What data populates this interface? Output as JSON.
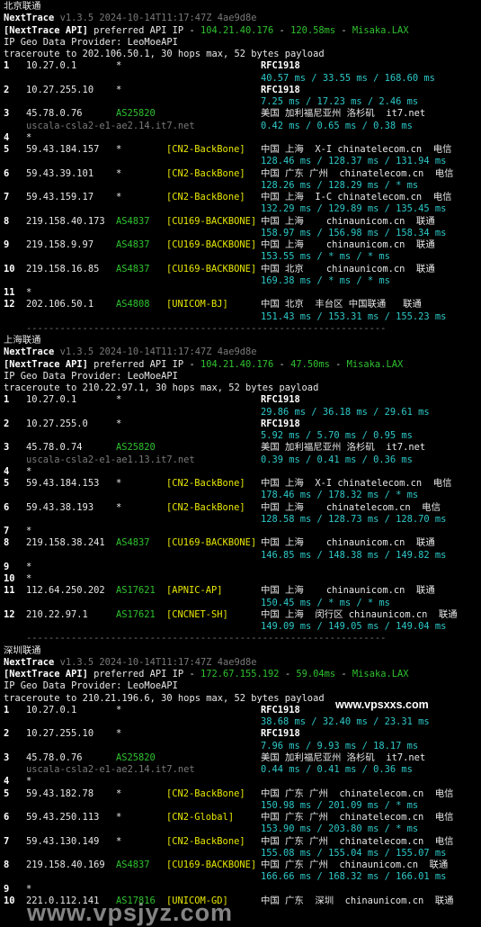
{
  "blocks": [
    {
      "header": "北京联通",
      "version": "v1.3.5 2024-10-14T11:17:47Z 4ae9d8e",
      "api_ip": "104.21.40.176",
      "api_latency": "120.58ms",
      "api_node": "Misaka.LAX",
      "traceroute": "traceroute to 202.106.50.1, 30 hops max, 52 bytes payload",
      "hops": [
        {
          "n": "1",
          "ip": "10.27.0.1",
          "asn": "*",
          "tag": "",
          "geo": "RFC1918",
          "rtt": "40.57 ms / 33.55 ms / 168.60 ms",
          "sub": ""
        },
        {
          "n": "2",
          "ip": "10.27.255.10",
          "asn": "*",
          "tag": "",
          "geo": "RFC1918",
          "rtt": "7.25 ms / 17.23 ms / 2.46 ms",
          "sub": ""
        },
        {
          "n": "3",
          "ip": "45.78.0.76",
          "asn": "AS25820",
          "tag": "",
          "geo": "美国 加利福尼亚州 洛杉矶  it7.net",
          "rtt": "0.42 ms / 0.65 ms / 0.38 ms",
          "sub": "uscala-csla2-e1-ae2.14.it7.net"
        },
        {
          "n": "4",
          "ip": "*",
          "asn": "",
          "tag": "",
          "geo": "",
          "rtt": "",
          "sub": ""
        },
        {
          "n": "5",
          "ip": "59.43.184.157",
          "asn": "*",
          "tag": "[CN2-BackBone]",
          "geo": "中国 上海  X-I chinatelecom.cn  电信",
          "rtt": "128.46 ms / 128.37 ms / 131.94 ms",
          "sub": ""
        },
        {
          "n": "6",
          "ip": "59.43.39.101",
          "asn": "*",
          "tag": "[CN2-BackBone]",
          "geo": "中国 广东 广州  chinatelecom.cn  电信",
          "rtt": "128.26 ms / 128.29 ms / * ms",
          "sub": ""
        },
        {
          "n": "7",
          "ip": "59.43.159.17",
          "asn": "*",
          "tag": "[CN2-BackBone]",
          "geo": "中国 上海  I-C chinatelecom.cn  电信",
          "rtt": "132.29 ms / 129.89 ms / 135.45 ms",
          "sub": ""
        },
        {
          "n": "8",
          "ip": "219.158.40.173",
          "asn": "AS4837",
          "tag": "[CU169-BACKBONE]",
          "geo": "中国 上海    chinaunicom.cn  联通",
          "rtt": "158.97 ms / 156.98 ms / 158.34 ms",
          "sub": ""
        },
        {
          "n": "9",
          "ip": "219.158.9.97",
          "asn": "AS4837",
          "tag": "[CU169-BACKBONE]",
          "geo": "中国 上海    chinaunicom.cn  联通",
          "rtt": "153.55 ms / * ms / * ms",
          "sub": ""
        },
        {
          "n": "10",
          "ip": "219.158.16.85",
          "asn": "AS4837",
          "tag": "[CU169-BACKBONE]",
          "geo": "中国 北京    chinaunicom.cn  联通",
          "rtt": "169.38 ms / * ms / * ms",
          "sub": ""
        },
        {
          "n": "11",
          "ip": "*",
          "asn": "",
          "tag": "",
          "geo": "",
          "rtt": "",
          "sub": ""
        },
        {
          "n": "12",
          "ip": "202.106.50.1",
          "asn": "AS4808",
          "tag": "[UNICOM-BJ]",
          "geo": "中国 北京  丰台区 中国联通   联通",
          "rtt": "151.43 ms / 153.31 ms / 155.23 ms",
          "sub": ""
        }
      ]
    },
    {
      "header": "上海联通",
      "version": "v1.3.5 2024-10-14T11:17:47Z 4ae9d8e",
      "api_ip": "104.21.40.176",
      "api_latency": "47.50ms",
      "api_node": "Misaka.LAX",
      "traceroute": "traceroute to 210.22.97.1, 30 hops max, 52 bytes payload",
      "hops": [
        {
          "n": "1",
          "ip": "10.27.0.1",
          "asn": "*",
          "tag": "",
          "geo": "RFC1918",
          "rtt": "29.86 ms / 36.18 ms / 29.61 ms",
          "sub": ""
        },
        {
          "n": "2",
          "ip": "10.27.255.0",
          "asn": "*",
          "tag": "",
          "geo": "RFC1918",
          "rtt": "5.92 ms / 5.70 ms / 0.95 ms",
          "sub": ""
        },
        {
          "n": "3",
          "ip": "45.78.0.74",
          "asn": "AS25820",
          "tag": "",
          "geo": "美国 加利福尼亚州 洛杉矶  it7.net",
          "rtt": "0.39 ms / 0.41 ms / 0.36 ms",
          "sub": "uscala-csla2-e1-ae1.13.it7.net"
        },
        {
          "n": "4",
          "ip": "*",
          "asn": "",
          "tag": "",
          "geo": "",
          "rtt": "",
          "sub": ""
        },
        {
          "n": "5",
          "ip": "59.43.184.153",
          "asn": "*",
          "tag": "[CN2-BackBone]",
          "geo": "中国 上海  X-I chinatelecom.cn  电信",
          "rtt": "178.46 ms / 178.32 ms / * ms",
          "sub": ""
        },
        {
          "n": "6",
          "ip": "59.43.38.193",
          "asn": "*",
          "tag": "[CN2-BackBone]",
          "geo": "中国 上海    chinatelecom.cn  电信",
          "rtt": "128.58 ms / 128.73 ms / 128.70 ms",
          "sub": ""
        },
        {
          "n": "7",
          "ip": "*",
          "asn": "",
          "tag": "",
          "geo": "",
          "rtt": "",
          "sub": ""
        },
        {
          "n": "8",
          "ip": "219.158.38.241",
          "asn": "AS4837",
          "tag": "[CU169-BACKBONE]",
          "geo": "中国 上海    chinaunicom.cn  联通",
          "rtt": "146.85 ms / 148.38 ms / 149.82 ms",
          "sub": ""
        },
        {
          "n": "9",
          "ip": "*",
          "asn": "",
          "tag": "",
          "geo": "",
          "rtt": "",
          "sub": ""
        },
        {
          "n": "10",
          "ip": "*",
          "asn": "",
          "tag": "",
          "geo": "",
          "rtt": "",
          "sub": ""
        },
        {
          "n": "11",
          "ip": "112.64.250.202",
          "asn": "AS17621",
          "tag": "[APNIC-AP]",
          "geo": "中国 上海    chinaunicom.cn  联通",
          "rtt": "150.45 ms / * ms / * ms",
          "sub": ""
        },
        {
          "n": "12",
          "ip": "210.22.97.1",
          "asn": "AS17621",
          "tag": "[CNCNET-SH]",
          "geo": "中国 上海  闵行区 chinaunicom.cn  联通",
          "rtt": "149.09 ms / 149.05 ms / 149.04 ms",
          "sub": ""
        }
      ]
    },
    {
      "header": "深圳联通",
      "version": "v1.3.5 2024-10-14T11:17:47Z 4ae9d8e",
      "api_ip": "172.67.155.192",
      "api_latency": "59.04ms",
      "api_node": "Misaka.LAX",
      "traceroute": "traceroute to 210.21.196.6, 30 hops max, 52 bytes payload",
      "hops": [
        {
          "n": "1",
          "ip": "10.27.0.1",
          "asn": "*",
          "tag": "",
          "geo": "RFC1918",
          "rtt": "38.68 ms / 32.40 ms / 23.31 ms",
          "sub": ""
        },
        {
          "n": "2",
          "ip": "10.27.255.10",
          "asn": "*",
          "tag": "",
          "geo": "RFC1918",
          "rtt": "7.96 ms / 9.93 ms / 18.17 ms",
          "sub": ""
        },
        {
          "n": "3",
          "ip": "45.78.0.76",
          "asn": "AS25820",
          "tag": "",
          "geo": "美国 加利福尼亚州 洛杉矶  it7.net",
          "rtt": "0.44 ms / 0.41 ms / 0.36 ms",
          "sub": "uscala-csla2-e1-ae2.14.it7.net"
        },
        {
          "n": "4",
          "ip": "*",
          "asn": "",
          "tag": "",
          "geo": "",
          "rtt": "",
          "sub": ""
        },
        {
          "n": "5",
          "ip": "59.43.182.78",
          "asn": "*",
          "tag": "[CN2-BackBone]",
          "geo": "中国 广东 广州  chinatelecom.cn  电信",
          "rtt": "150.98 ms / 201.09 ms / * ms",
          "sub": ""
        },
        {
          "n": "6",
          "ip": "59.43.250.113",
          "asn": "*",
          "tag": "[CN2-Global]",
          "geo": "中国 广东 广州  chinatelecom.cn  电信",
          "rtt": "153.90 ms / 203.80 ms / * ms",
          "sub": ""
        },
        {
          "n": "7",
          "ip": "59.43.130.149",
          "asn": "*",
          "tag": "[CN2-BackBone]",
          "geo": "中国 广东 广州  chinatelecom.cn  电信",
          "rtt": "155.08 ms / 155.04 ms / 155.07 ms",
          "sub": ""
        },
        {
          "n": "8",
          "ip": "219.158.40.169",
          "asn": "AS4837",
          "tag": "[CU169-BACKBONE]",
          "geo": "中国 广东 广州  chinaunicom.cn  联通",
          "rtt": "166.66 ms / 168.32 ms / 166.01 ms",
          "sub": ""
        },
        {
          "n": "9",
          "ip": "*",
          "asn": "",
          "tag": "",
          "geo": "",
          "rtt": "",
          "sub": ""
        },
        {
          "n": "10",
          "ip": "221.0.112.141",
          "asn": "AS17816",
          "tag": "[UNICOM-GD]",
          "geo": "中国 广东  深圳  chinaunicom.cn  联通",
          "rtt": "",
          "sub": ""
        }
      ]
    }
  ],
  "labels": {
    "api_tag": "[NextTrace API]",
    "preferred": " preferred API IP - ",
    "app_name": "NextTrace",
    "geo_provider": "IP Geo Data Provider: LeoMoeAPI",
    "separator": "----------------------------------------------------------------"
  },
  "watermarks": {
    "center": "www.vpsxxs.com",
    "bottom": "www.vpsjyz.com"
  }
}
